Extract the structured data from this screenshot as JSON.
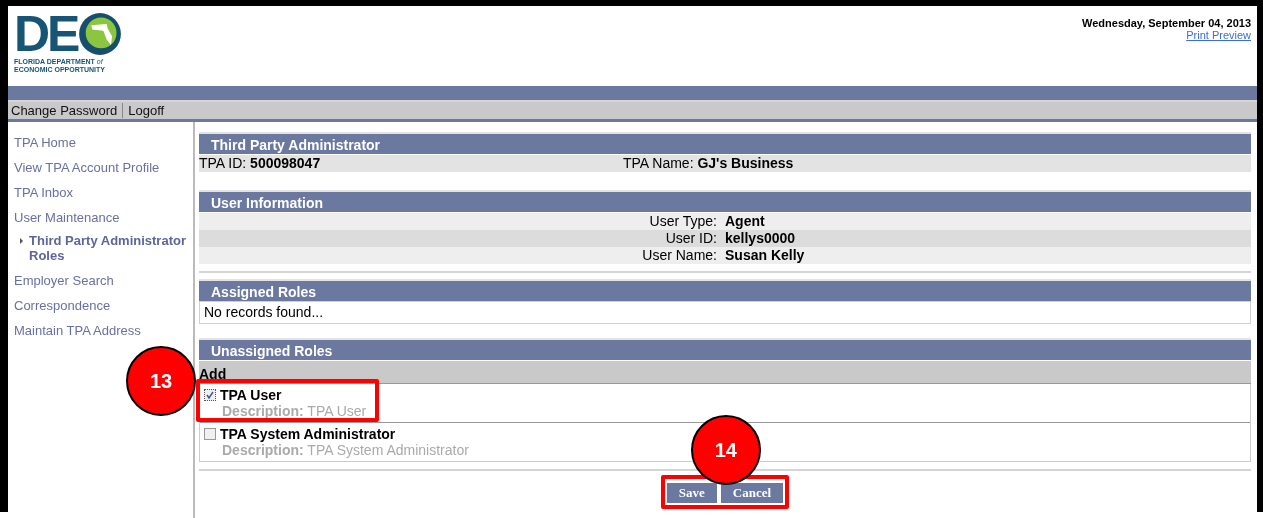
{
  "logo": {
    "letters": "DE",
    "line1": "FLORIDA DEPARTMENT",
    "line1_small": "of",
    "line2": "ECONOMIC OPPORTUNITY"
  },
  "date": "Wednesday, September 04, 2013",
  "print_preview": "Print Preview",
  "nav": [
    "Change Password",
    "Logoff"
  ],
  "sidebar": {
    "items": [
      {
        "label": "TPA Home",
        "selected": false
      },
      {
        "label": "View TPA Account Profile",
        "selected": false
      },
      {
        "label": "TPA Inbox",
        "selected": false
      },
      {
        "label": "User Maintenance",
        "selected": false,
        "children": [
          {
            "label": "Third Party Administrator Roles",
            "selected": true
          }
        ]
      },
      {
        "label": "Employer Search",
        "selected": false
      },
      {
        "label": "Correspondence",
        "selected": false
      },
      {
        "label": "Maintain TPA Address",
        "selected": false
      }
    ]
  },
  "tpa": {
    "title": "Third Party Administrator",
    "id_label": "TPA ID:",
    "id": "500098047",
    "name_label": "TPA Name:",
    "name": "GJ's Business"
  },
  "user_info": {
    "title": "User Information",
    "rows": [
      {
        "label": "User Type:",
        "value": "Agent"
      },
      {
        "label": "User ID:",
        "value": "kellys0000"
      },
      {
        "label": "User Name:",
        "value": "Susan Kelly"
      }
    ]
  },
  "assigned_roles": {
    "title": "Assigned Roles",
    "empty": "No records found..."
  },
  "unassigned_roles": {
    "title": "Unassigned Roles",
    "column": "Add",
    "roles": [
      {
        "name": "TPA User",
        "description_label": "Description:",
        "description": "TPA User",
        "checked": true,
        "callout": "13"
      },
      {
        "name": "TPA System Administrator",
        "description_label": "Description:",
        "description": "TPA System Administrator",
        "checked": false
      }
    ]
  },
  "actions": {
    "buttons": [
      "Save",
      "Cancel"
    ],
    "callout": "14"
  }
}
